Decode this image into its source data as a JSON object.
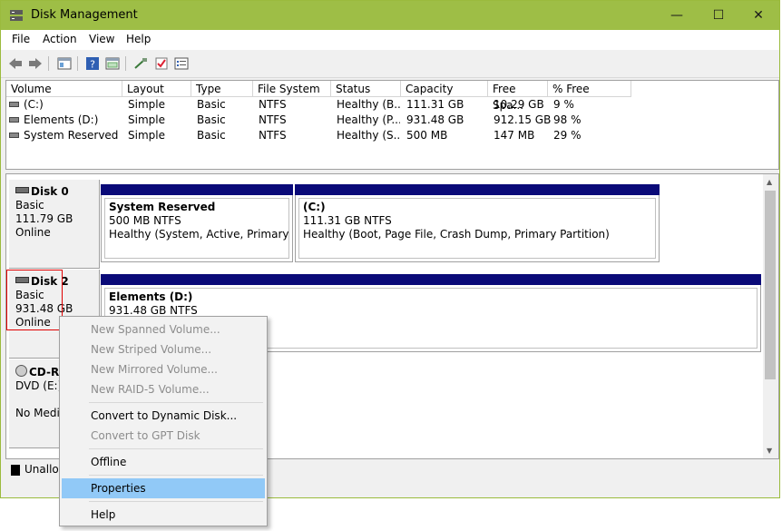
{
  "window": {
    "title": "Disk Management",
    "minimize": "—",
    "maximize": "☐",
    "close": "✕"
  },
  "menu": [
    "File",
    "Action",
    "View",
    "Help"
  ],
  "columns": [
    "Volume",
    "Layout",
    "Type",
    "File System",
    "Status",
    "Capacity",
    "Free Spa...",
    "% Free"
  ],
  "volumes": [
    {
      "volume": "(C:)",
      "layout": "Simple",
      "type": "Basic",
      "fs": "NTFS",
      "status": "Healthy (B...",
      "capacity": "111.31 GB",
      "free": "10.29 GB",
      "pct": "9 %"
    },
    {
      "volume": "Elements (D:)",
      "layout": "Simple",
      "type": "Basic",
      "fs": "NTFS",
      "status": "Healthy (P...",
      "capacity": "931.48 GB",
      "free": "912.15 GB",
      "pct": "98 %"
    },
    {
      "volume": "System Reserved",
      "layout": "Simple",
      "type": "Basic",
      "fs": "NTFS",
      "status": "Healthy (S...",
      "capacity": "500 MB",
      "free": "147 MB",
      "pct": "29 %"
    }
  ],
  "disks": [
    {
      "name": "Disk 0",
      "type": "Basic",
      "size": "111.79 GB",
      "status": "Online"
    },
    {
      "name": "Disk 2",
      "type": "Basic",
      "size": "931.48 GB",
      "status": "Online"
    },
    {
      "name": "CD-RO",
      "type": "DVD (E:)",
      "size": "",
      "status": "No Media"
    }
  ],
  "partitions": {
    "sysres": {
      "name": "System Reserved",
      "size": "500 MB NTFS",
      "status": "Healthy (System, Active, Primary Parti"
    },
    "c": {
      "name": "(C:)",
      "size": "111.31 GB NTFS",
      "status": "Healthy (Boot, Page File, Crash Dump, Primary Partition)"
    },
    "d": {
      "name": "Elements  (D:)",
      "size": "931.48 GB NTFS",
      "status": ""
    }
  },
  "legend": {
    "unallocated": "Unalloc"
  },
  "context_menu": {
    "new_spanned": "New Spanned Volume...",
    "new_striped": "New Striped Volume...",
    "new_mirrored": "New Mirrored Volume...",
    "new_raid5": "New RAID-5 Volume...",
    "convert_dynamic": "Convert to Dynamic Disk...",
    "convert_gpt": "Convert to GPT Disk",
    "offline": "Offline",
    "properties": "Properties",
    "help": "Help"
  },
  "colors": {
    "titlebar": "#9ebe46",
    "partition_bar": "#0a0a78",
    "selection": "#91c9f7",
    "highlight_box": "#e00000"
  }
}
